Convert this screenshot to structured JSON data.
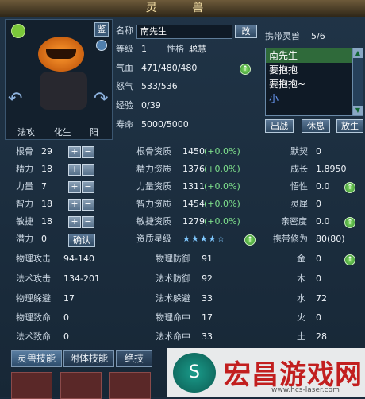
{
  "window": {
    "title": "灵 兽"
  },
  "portrait": {
    "jian_label": "鉴",
    "stats": [
      "法攻",
      "化生",
      "阳"
    ]
  },
  "basic": {
    "name_label": "名称",
    "name_value": "南先生",
    "rename_button": "改",
    "level_label": "等级",
    "level_value": "1",
    "personality_label": "性格",
    "personality_value": "聪慧",
    "hp_label": "气血",
    "hp_value": "471/480/480",
    "anger_label": "怒气",
    "anger_value": "533/536",
    "exp_label": "经验",
    "exp_value": "0/39",
    "life_label": "寿命",
    "life_value": "5000/5000"
  },
  "carry": {
    "label": "携带灵兽",
    "count": "5/6",
    "list": [
      "南先生",
      "要抱抱",
      "要抱抱~",
      "小"
    ],
    "selected_index": 0,
    "buttons": {
      "fight": "出战",
      "rest": "休息",
      "release": "放生"
    }
  },
  "attributes": [
    {
      "label": "根骨",
      "value": "29",
      "apt_label": "根骨资质",
      "apt_value": "1450",
      "apt_pct": "(+0.0%)",
      "right_label": "默契",
      "right_value": "0",
      "right_up": false
    },
    {
      "label": "精力",
      "value": "18",
      "apt_label": "精力资质",
      "apt_value": "1376",
      "apt_pct": "(+0.0%)",
      "right_label": "成长",
      "right_value": "1.8950",
      "right_up": false
    },
    {
      "label": "力量",
      "value": "7",
      "apt_label": "力量资质",
      "apt_value": "1311",
      "apt_pct": "(+0.0%)",
      "right_label": "悟性",
      "right_value": "0.0",
      "right_up": true
    },
    {
      "label": "智力",
      "value": "18",
      "apt_label": "智力资质",
      "apt_value": "1454",
      "apt_pct": "(+0.0%)",
      "right_label": "灵犀",
      "right_value": "0",
      "right_up": false
    },
    {
      "label": "敏捷",
      "value": "18",
      "apt_label": "敏捷资质",
      "apt_value": "1279",
      "apt_pct": "(+0.0%)",
      "right_label": "亲密度",
      "right_value": "0.0",
      "right_up": true
    }
  ],
  "potential": {
    "label": "潜力",
    "value": "0",
    "confirm_button": "确认",
    "star_label": "资质星级",
    "stars": "★★★★☆",
    "cultivation_label": "携带修为",
    "cultivation_value": "80(80)"
  },
  "combat": [
    {
      "l1": "物理攻击",
      "v1": "94-140",
      "l2": "物理防御",
      "v2": "91",
      "l3": "金",
      "v3": "0",
      "up": true
    },
    {
      "l1": "法术攻击",
      "v1": "134-201",
      "l2": "法术防御",
      "v2": "92",
      "l3": "木",
      "v3": "0",
      "up": false
    },
    {
      "l1": "物理躲避",
      "v1": "17",
      "l2": "法术躲避",
      "v2": "33",
      "l3": "水",
      "v3": "72",
      "up": false
    },
    {
      "l1": "物理致命",
      "v1": "0",
      "l2": "物理命中",
      "v2": "17",
      "l3": "火",
      "v3": "0",
      "up": false
    },
    {
      "l1": "法术致命",
      "v1": "0",
      "l2": "法术命中",
      "v2": "33",
      "l3": "土",
      "v3": "28",
      "up": false
    }
  ],
  "tabs": [
    "灵兽技能",
    "附体技能",
    "绝技"
  ],
  "watermark": {
    "logo": "S",
    "text": "宏昌游戏网",
    "url": "www.hcs-laser.com"
  }
}
